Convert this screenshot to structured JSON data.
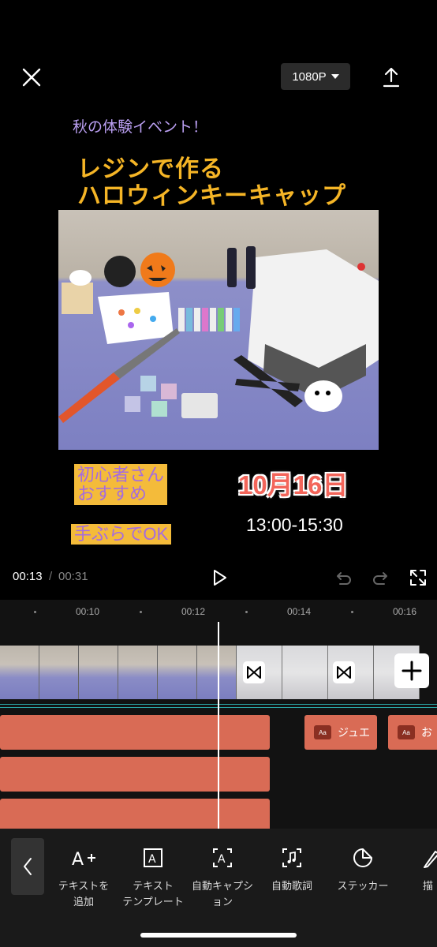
{
  "header": {
    "resolution": "1080P"
  },
  "poster": {
    "event_text": "秋の体験イベント！",
    "title_line1": "レジンで作る",
    "title_line2": "ハロウィンキーキャップ",
    "badge_beginner_line1": "初心者さん",
    "badge_beginner_line2": "おすすめ",
    "badge_handsfree": "手ぶらでOK",
    "date": "10月16日",
    "time": "13:00-15:30"
  },
  "playback": {
    "current_time": "00:13",
    "separator": "/",
    "total_time": "00:31"
  },
  "timeline": {
    "ruler": [
      "00:10",
      "00:12",
      "00:14",
      "00:16"
    ],
    "text_chips": [
      {
        "icon": "Aa",
        "label": "ジュエ"
      },
      {
        "icon": "Aa",
        "label": "お"
      }
    ]
  },
  "toolbar": {
    "tools": [
      {
        "icon": "add-text-icon",
        "label": "テキストを\n追加"
      },
      {
        "icon": "text-template-icon",
        "label": "テキスト\nテンプレート"
      },
      {
        "icon": "auto-caption-icon",
        "label": "自動キャプシ\nョン"
      },
      {
        "icon": "auto-lyrics-icon",
        "label": "自動歌詞"
      },
      {
        "icon": "sticker-icon",
        "label": "ステッカー"
      },
      {
        "icon": "draw-icon",
        "label": "描"
      }
    ]
  },
  "colors": {
    "clip_accent": "#d96b55",
    "poster_yellow": "#f5b526",
    "poster_purple": "#a46be0",
    "poster_date": "#f3655a"
  }
}
